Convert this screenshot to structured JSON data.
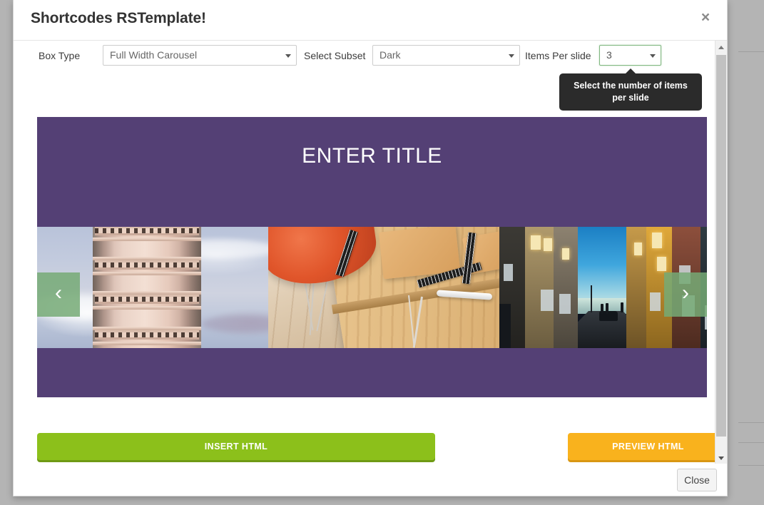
{
  "modal": {
    "title": "Shortcodes RSTemplate!",
    "close_icon": "close-icon",
    "close_button_label": "Close"
  },
  "toolbar": {
    "box_type": {
      "label": "Box Type",
      "value": "Full Width Carousel",
      "caret_icon": "chevron-down-icon"
    },
    "select_subset": {
      "label": "Select Subset",
      "value": "Dark",
      "caret_icon": "chevron-down-icon"
    },
    "items_per_slide": {
      "label": "Items Per slide",
      "value": "3",
      "caret_icon": "chevron-down-icon",
      "focus_border_color": "#7fb77f"
    }
  },
  "tooltip": {
    "text": "Select the number of items per slide",
    "background": "#2b2b2b"
  },
  "carousel": {
    "title": "ENTER TITLE",
    "background": "#544075",
    "prev_icon": "chevron-left-icon",
    "next_icon": "chevron-right-icon",
    "nav_color": "#76aa76",
    "slides": [
      {
        "alt": "leaning-tower-of-pisa"
      },
      {
        "alt": "orange-chair-wooden-desk-notebooks"
      },
      {
        "alt": "narrow-street-at-dusk-seaside"
      }
    ]
  },
  "actions": {
    "insert_html": {
      "label": "INSERT HTML",
      "color": "#8cc01b"
    },
    "preview_html": {
      "label": "PREVIEW HTML",
      "color": "#f9b21d"
    }
  },
  "scrollbar": {
    "up_icon": "triangle-up-icon",
    "down_icon": "triangle-down-icon"
  }
}
